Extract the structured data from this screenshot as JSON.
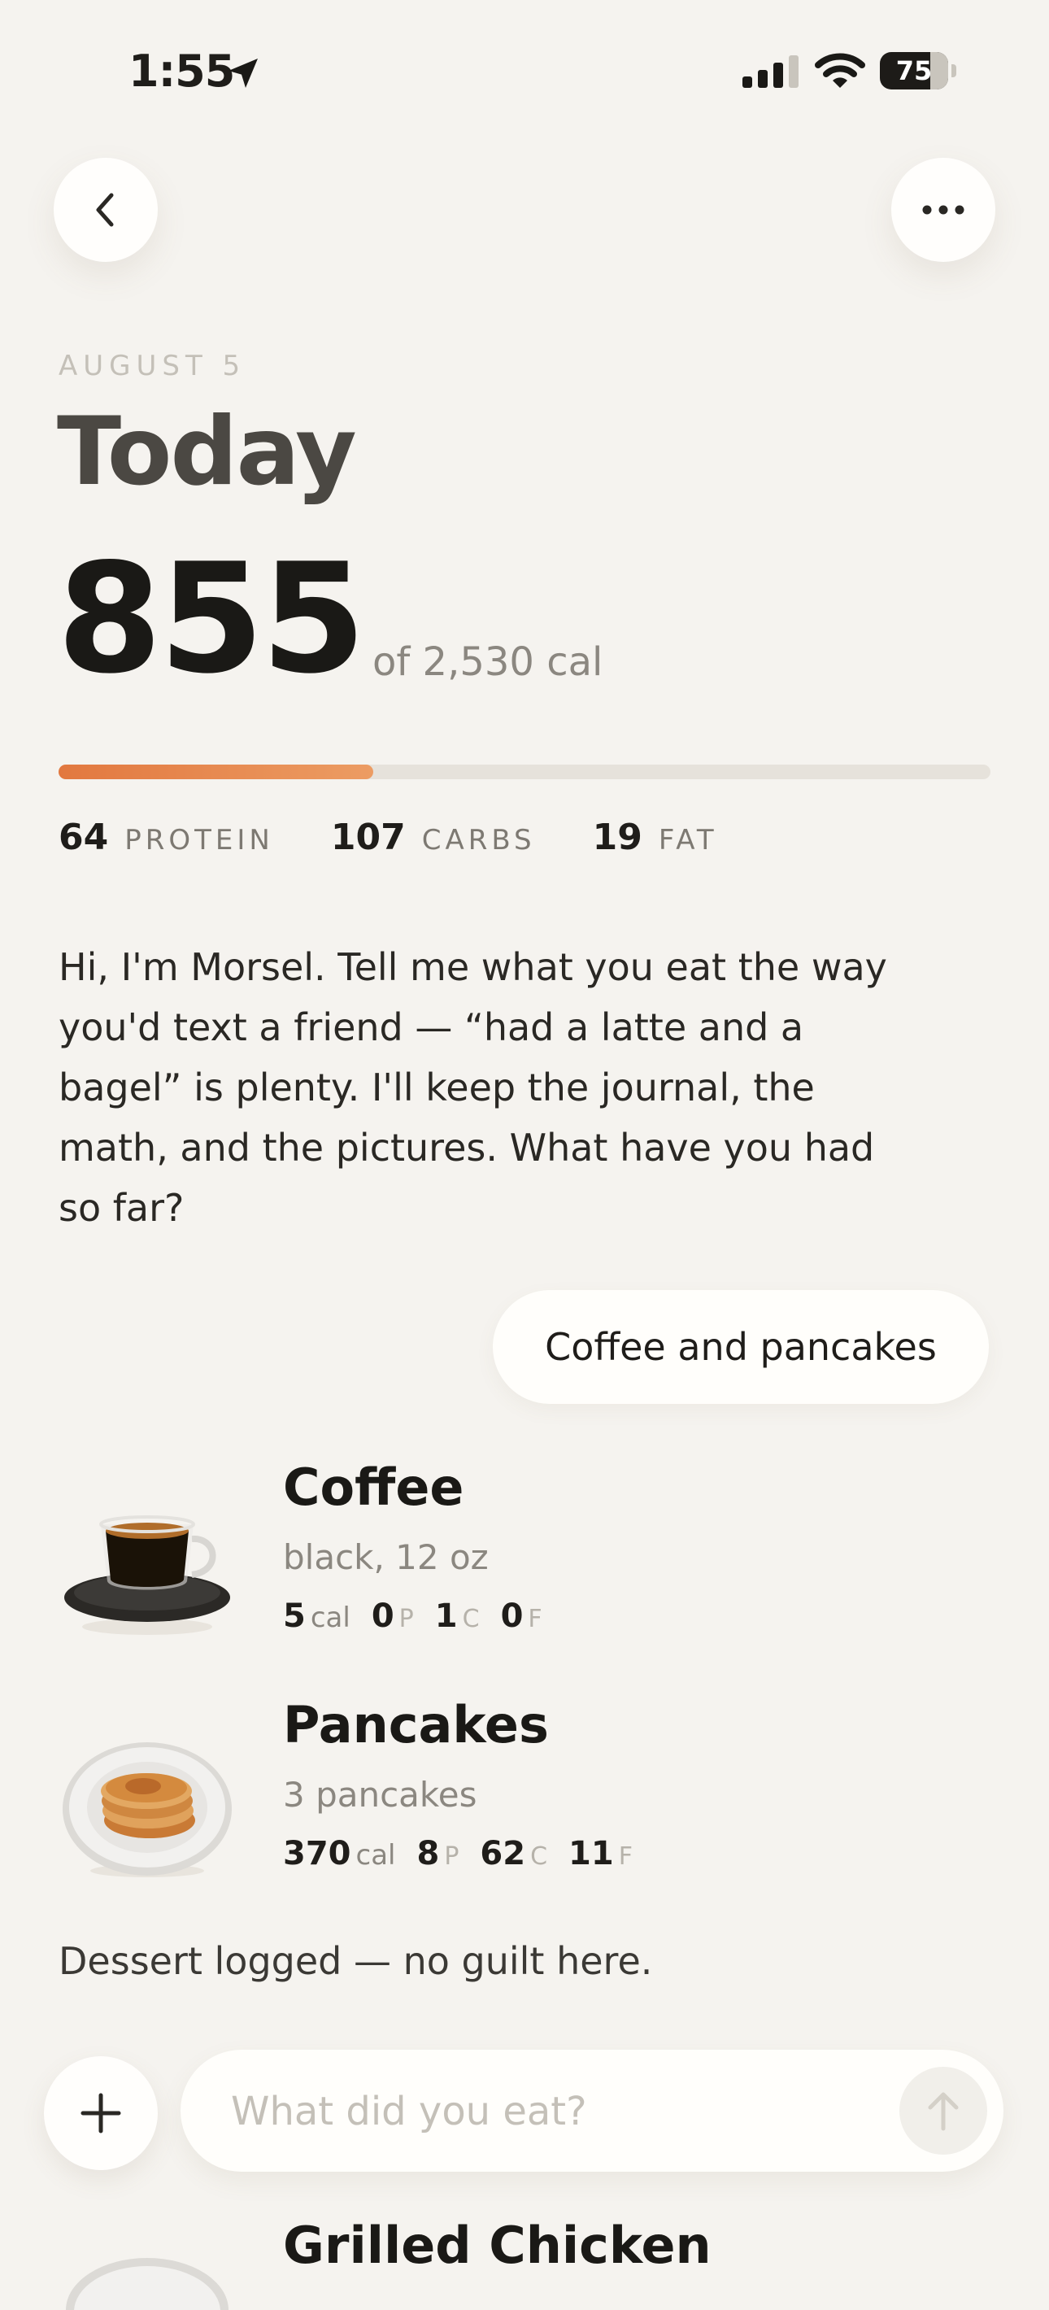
{
  "status_bar": {
    "time": "1:55",
    "battery": "75"
  },
  "header": {
    "date": "AUGUST 5",
    "title": "Today",
    "calories": "855",
    "calorie_goal": "of 2,530 cal",
    "progress_fraction": 0.338
  },
  "macros": [
    {
      "value": "64",
      "label": "PROTEIN"
    },
    {
      "value": "107",
      "label": "CARBS"
    },
    {
      "value": "19",
      "label": "FAT"
    }
  ],
  "chat": {
    "intro": "Hi, I'm Morsel. Tell me what you eat the way you'd text a friend — “had a latte and a bagel” is plenty. I'll keep the journal, the math, and the pictures. What have you had so far?",
    "user_message": "Coffee and pancakes",
    "note": "Dessert logged — no guilt here."
  },
  "foods": [
    {
      "name": "Coffee",
      "desc": "black, 12 oz",
      "cal": "5",
      "cal_unit": "cal",
      "p": "0",
      "c": "1",
      "f": "0",
      "p_unit": "P",
      "c_unit": "C",
      "f_unit": "F"
    },
    {
      "name": "Pancakes",
      "desc": "3 pancakes",
      "cal": "370",
      "cal_unit": "cal",
      "p": "8",
      "c": "62",
      "f": "11",
      "p_unit": "P",
      "c_unit": "C",
      "f_unit": "F"
    }
  ],
  "composer": {
    "placeholder": "What did you eat?"
  },
  "peek_item": {
    "name": "Grilled Chicken"
  }
}
